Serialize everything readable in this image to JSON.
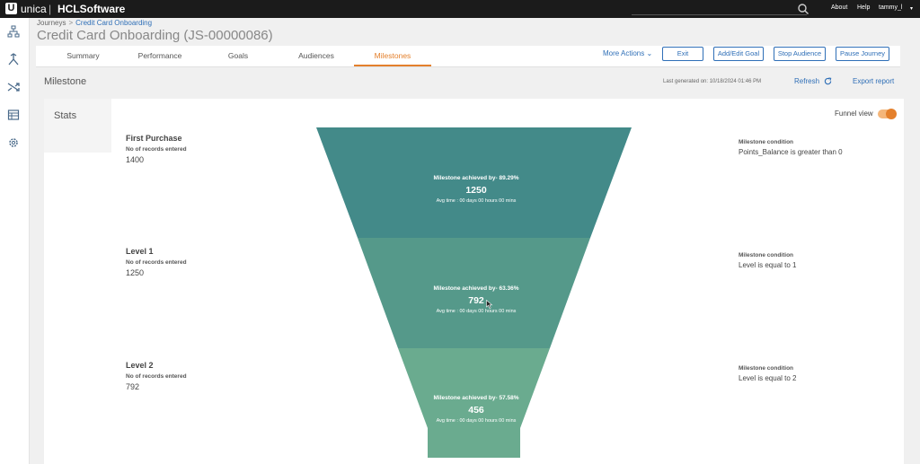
{
  "topbar": {
    "logo_letter": "U",
    "brand_unica": "unica",
    "brand_sep": "|",
    "brand_hcl": "HCLSoftware",
    "about": "About",
    "help": "Help",
    "user": "tammy_l",
    "user_caret": "▾"
  },
  "breadcrumb": {
    "root": "Journeys",
    "sep": ">",
    "current": "Credit Card Onboarding"
  },
  "page_title": "Credit Card Onboarding (JS-00000086)",
  "tabs": [
    {
      "label": "Summary"
    },
    {
      "label": "Performance"
    },
    {
      "label": "Goals"
    },
    {
      "label": "Audiences"
    },
    {
      "label": "Milestones",
      "active": true
    }
  ],
  "actions": {
    "more": "More Actions",
    "more_caret": "⌄",
    "exit": "Exit",
    "add_goal": "Add/Edit Goal",
    "stop": "Stop Audience",
    "pause": "Pause Journey"
  },
  "milestone": {
    "heading": "Milestone",
    "last_generated": "Last generated on: 10/18/2024 01:46 PM",
    "refresh": "Refresh",
    "export": "Export report"
  },
  "stats": {
    "heading": "Stats",
    "funnel_view_label": "Funnel view",
    "funnel_view_on": true
  },
  "stages": [
    {
      "name": "First Purchase",
      "records_label": "No of records entered",
      "records": "1400",
      "achieved_label": "Milestone achieved by- 89.29%",
      "achieved_percent": 89.29,
      "achieved_count": "1250",
      "avg_time": "Avg time : 00 days 00 hours 00 mins",
      "condition_title": "Milestone condition",
      "condition": "Points_Balance is greater than 0",
      "color": "#438a89"
    },
    {
      "name": "Level 1",
      "records_label": "No of records entered",
      "records": "1250",
      "achieved_label": "Milestone achieved by- 63.36%",
      "achieved_percent": 63.36,
      "achieved_count": "792",
      "avg_time": "Avg time : 00 days 00 hours 00 mins",
      "condition_title": "Milestone condition",
      "condition": "Level is equal to 1",
      "color": "#55998a"
    },
    {
      "name": "Level 2",
      "records_label": "No of records entered",
      "records": "792",
      "achieved_label": "Milestone achieved by- 57.58%",
      "achieved_percent": 57.58,
      "achieved_count": "456",
      "avg_time": "Avg time : 00 days 00 hours 00 mins",
      "condition_title": "Milestone condition",
      "condition": "Level is equal to 2",
      "color": "#6aab8f"
    }
  ],
  "icons": {
    "search": "search-icon",
    "rail": [
      "hierarchy-icon",
      "merge-icon",
      "shuffle-icon",
      "table-icon",
      "gear-icon"
    ],
    "refresh": "refresh-icon"
  },
  "colors": {
    "accent": "#e4802c",
    "link": "#2f6fb7",
    "topbar": "#1b1b1b"
  }
}
